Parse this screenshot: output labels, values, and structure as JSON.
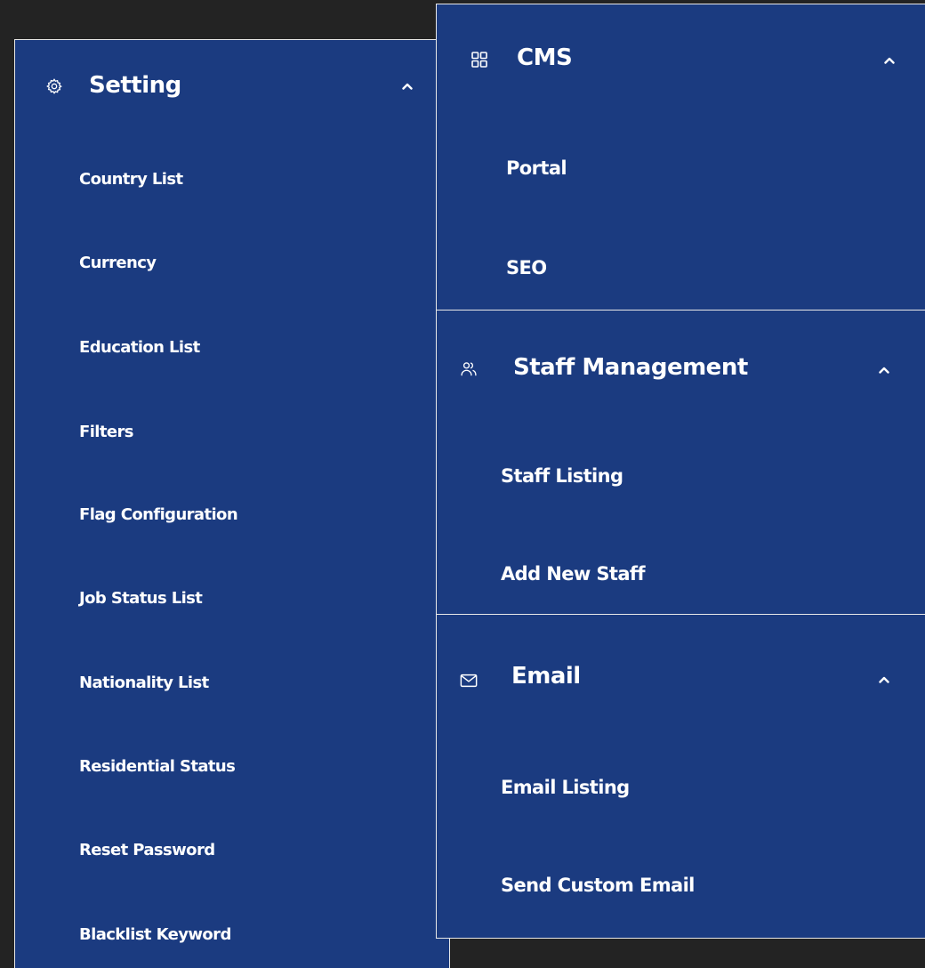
{
  "setting": {
    "title": "Setting",
    "icon": "gear-icon",
    "items": [
      "Country List",
      "Currency",
      "Education List",
      "Filters",
      "Flag Configuration",
      "Job Status List",
      "Nationality List",
      "Residential Status",
      "Reset Password",
      "Blacklist Keyword"
    ]
  },
  "cms": {
    "title": "CMS",
    "icon": "grid-icon",
    "items": [
      "Portal",
      "SEO"
    ]
  },
  "staff": {
    "title": "Staff Management",
    "icon": "users-icon",
    "items": [
      "Staff Listing",
      "Add New Staff"
    ]
  },
  "email": {
    "title": "Email",
    "icon": "mail-icon",
    "items": [
      "Email Listing",
      "Send Custom Email"
    ]
  },
  "colors": {
    "panel": "#1b3b80",
    "background": "#232323",
    "text": "#ffffff",
    "border": "#e8e8e8"
  }
}
